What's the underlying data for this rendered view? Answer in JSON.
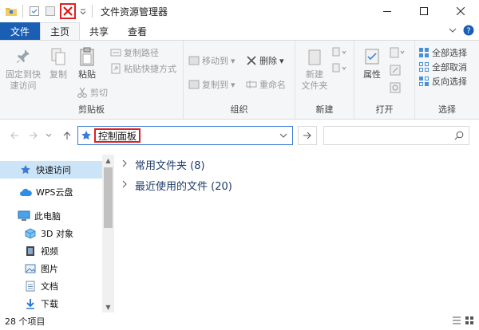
{
  "window": {
    "title": "文件资源管理器"
  },
  "tabs": {
    "file": "文件",
    "home": "主页",
    "share": "共享",
    "view": "查看"
  },
  "ribbon": {
    "clipboard": {
      "pin_quick_access": "固定到快\n速访问",
      "copy": "复制",
      "paste": "粘贴",
      "copy_path": "复制路径",
      "paste_shortcut": "粘贴快捷方式",
      "cut": "剪切",
      "label": "剪贴板"
    },
    "organize": {
      "move_to": "移动到",
      "delete": "删除",
      "copy_to": "复制到",
      "rename": "重命名",
      "label": "组织"
    },
    "new": {
      "new_folder": "新建\n文件夹",
      "label": "新建"
    },
    "open": {
      "properties": "属性",
      "label": "打开"
    },
    "select": {
      "select_all": "全部选择",
      "select_none": "全部取消",
      "invert_selection": "反向选择",
      "label": "选择"
    }
  },
  "address": {
    "path": "控制面板"
  },
  "nav": {
    "items": [
      {
        "label": "快速访问",
        "icon": "star-icon"
      },
      {
        "label": "WPS云盘",
        "icon": "cloud-icon"
      },
      {
        "label": "此电脑",
        "icon": "computer-icon"
      },
      {
        "label": "3D 对象",
        "icon": "cube-icon"
      },
      {
        "label": "视频",
        "icon": "video-icon"
      },
      {
        "label": "图片",
        "icon": "picture-icon"
      },
      {
        "label": "文档",
        "icon": "document-icon"
      },
      {
        "label": "下载",
        "icon": "download-icon"
      }
    ]
  },
  "content": {
    "groups": [
      {
        "label": "常用文件夹 (8)"
      },
      {
        "label": "最近使用的文件 (20)"
      }
    ]
  },
  "status": {
    "count": "28 个项目"
  },
  "colors": {
    "accent": "#1a5fb4",
    "highlight_box": "#e02020",
    "selection": "#cce4f7"
  }
}
